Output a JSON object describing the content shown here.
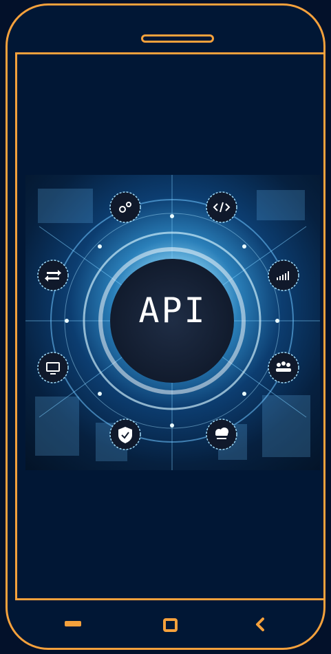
{
  "app": {
    "title": "API"
  },
  "screen": {
    "image_icons": [
      "gear-icon",
      "code-icon",
      "signal-bars-icon",
      "group-icon",
      "cloud-icon",
      "shield-check-icon",
      "monitor-icon",
      "transfer-arrows-icon"
    ]
  },
  "navigation": {
    "buttons": [
      "menu-icon",
      "home-icon",
      "back-icon"
    ]
  },
  "colors": {
    "frame": "#f5a13c",
    "background": "#011735",
    "glow": "#8fd6f6"
  }
}
